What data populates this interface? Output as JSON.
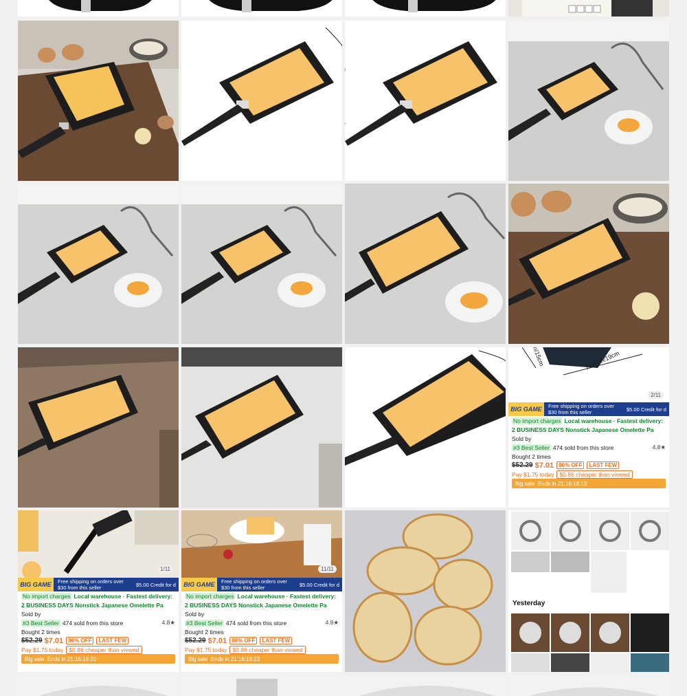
{
  "colors": {
    "accent": "#f37021",
    "brand_blue": "#1d3e8f",
    "banner_yellow": "#f7c948",
    "green": "#0a8a2a"
  },
  "product_card": {
    "banner_label": "BIG GAME",
    "free_shipping": "Free shipping on orders over $30 from this seller",
    "credit": "$5.00 Credit for d",
    "no_import": "No import charges",
    "local_warehouse": "Local warehouse · Fastest delivery:",
    "title_line": "2 BUSINESS DAYS Nonstick Japanese Omelette Pa",
    "sold_by": "Sold by",
    "best_seller": "#3 Best Seller",
    "sold": "474 sold",
    "from_store": "from this store",
    "rating": "4.8★",
    "bought": "Bought 2 times",
    "old_price": "$52.29",
    "new_price": "$7.01",
    "discount": "86% OFF",
    "last_few": "LAST FEW",
    "pay_today": "Pay $1.75 today",
    "cheaper": "$0.86 cheaper than viewed",
    "big_sale": "Big sale",
    "ends_in": "Ends in 21:16:18:13",
    "ends_in_b": "Ends in 21:16:18:20",
    "ends_in_c": "Ends in 21:16:18:23"
  },
  "counters": {
    "card_a": "2/11",
    "card_b": "1/11",
    "card_c": "11/11"
  },
  "dimensions": {
    "width": "7.5inch/19cm",
    "depth": "ch/15cm"
  },
  "history": {
    "yesterday_label": "Yesterday"
  }
}
